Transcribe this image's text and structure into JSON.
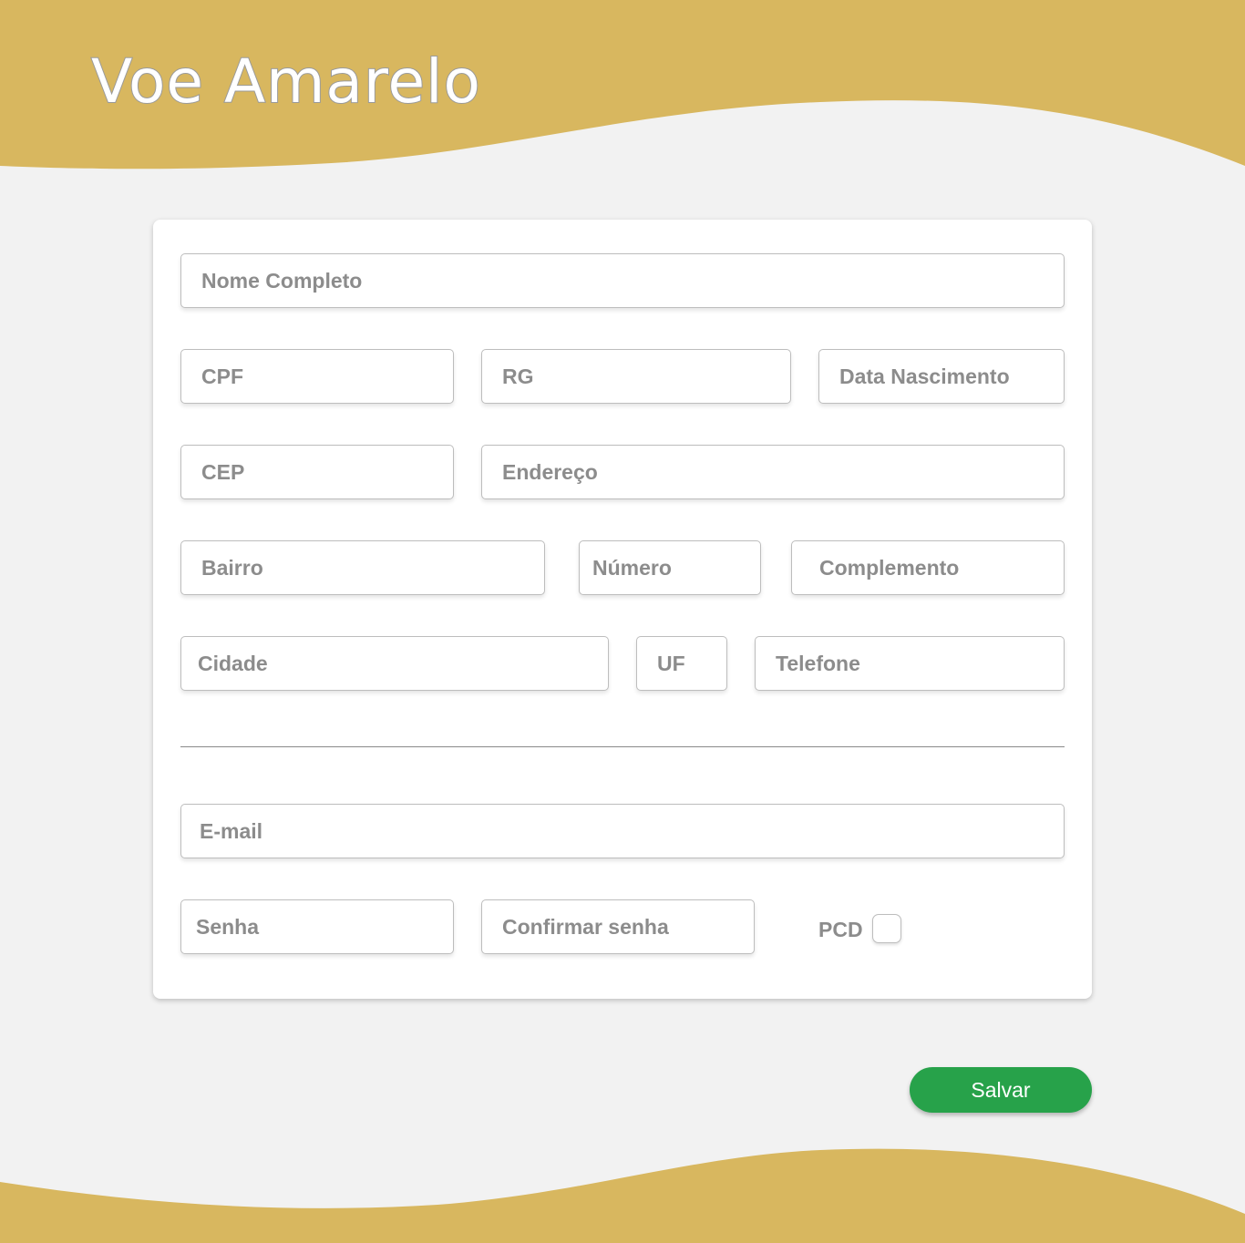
{
  "app": {
    "title": "Voe Amarelo"
  },
  "colors": {
    "brand_yellow": "#d8b75f",
    "background": "#f2f2f2",
    "save_green": "#27a24a"
  },
  "form": {
    "nome_placeholder": "Nome Completo",
    "cpf_placeholder": "CPF",
    "rg_placeholder": "RG",
    "nascimento_placeholder": "Data Nascimento",
    "cep_placeholder": "CEP",
    "endereco_placeholder": "Endereço",
    "bairro_placeholder": "Bairro",
    "numero_placeholder": "Número",
    "complemento_placeholder": "Complemento",
    "cidade_placeholder": "Cidade",
    "uf_placeholder": "UF",
    "telefone_placeholder": "Telefone",
    "email_placeholder": "E-mail",
    "senha_placeholder": "Senha",
    "confirmar_senha_placeholder": "Confirmar senha",
    "pcd_label": "PCD",
    "pcd_checked": false
  },
  "actions": {
    "save_label": "Salvar"
  }
}
